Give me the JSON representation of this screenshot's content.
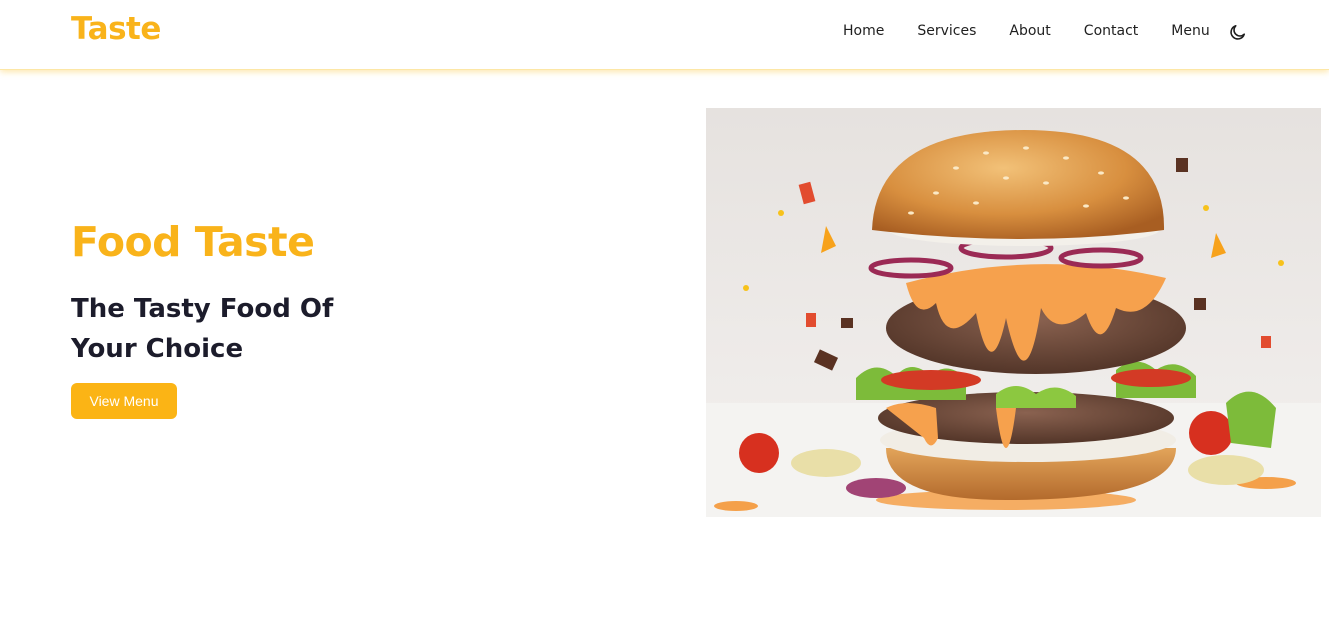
{
  "brand": {
    "name": "Taste",
    "accent": "#f9b31a"
  },
  "nav": {
    "items": [
      {
        "label": "Home"
      },
      {
        "label": "Services"
      },
      {
        "label": "About"
      },
      {
        "label": "Contact"
      },
      {
        "label": "Menu"
      }
    ],
    "theme_toggle_icon": "moon-icon"
  },
  "hero": {
    "subtitle": "Food Taste",
    "title": "The Tasty Food Of Your Choice",
    "cta_label": "View Menu",
    "image_icon": "burger-photo"
  },
  "colors": {
    "primary": "#fbb415",
    "heading": "#1c1c2b",
    "text": "#1f1f1f"
  }
}
